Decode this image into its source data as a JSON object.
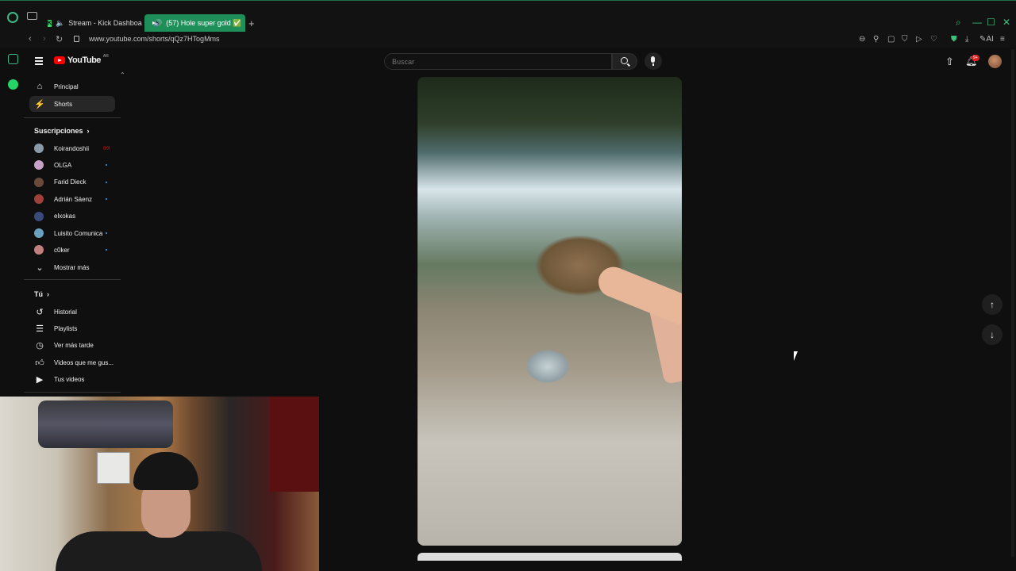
{
  "browser": {
    "tabs": [
      {
        "label": "Stream - Kick Dashboa",
        "active": false
      },
      {
        "label": "(57) Hole super gold ✅",
        "active": true
      }
    ],
    "new_tab": "+",
    "url": "www.youtube.com/shorts/qQz7HTogMms",
    "ai_label": "AI"
  },
  "youtube": {
    "logo_text": "YouTube",
    "country_code": "AR",
    "search_placeholder": "Buscar",
    "notification_count": "9+"
  },
  "sidebar": {
    "main": [
      {
        "label": "Principal",
        "icon": "home-icon"
      },
      {
        "label": "Shorts",
        "icon": "shorts-icon",
        "active": true
      }
    ],
    "subscriptions_title": "Suscripciones",
    "subscriptions": [
      {
        "label": "Koirandoshii",
        "status": "live",
        "live_text": "((•))",
        "color": "#8a9aa8"
      },
      {
        "label": "OLGA",
        "status": "new",
        "color": "#c8a0c8"
      },
      {
        "label": "Farid Dieck",
        "status": "new",
        "color": "#6a4a3a"
      },
      {
        "label": "Adrián Sáenz",
        "status": "new",
        "color": "#a0403a"
      },
      {
        "label": "elxokas",
        "status": "none",
        "color": "#3a4a7a"
      },
      {
        "label": "Luisito Comunica",
        "status": "new",
        "color": "#6aa0c0"
      },
      {
        "label": "c0ker",
        "status": "new",
        "color": "#c08080"
      }
    ],
    "show_more": "Mostrar más",
    "you_title": "Tú",
    "you_items": [
      {
        "label": "Historial",
        "icon": "history-icon"
      },
      {
        "label": "Playlists",
        "icon": "playlists-icon"
      },
      {
        "label": "Ver más tarde",
        "icon": "watch-later-icon"
      },
      {
        "label": "Videos que me gus...",
        "icon": "liked-icon"
      },
      {
        "label": "Tus videos",
        "icon": "your-videos-icon"
      }
    ]
  },
  "colors": {
    "accent": "#1f8f5a",
    "yt_red": "#ff0000",
    "new_dot": "#3ea6ff"
  }
}
